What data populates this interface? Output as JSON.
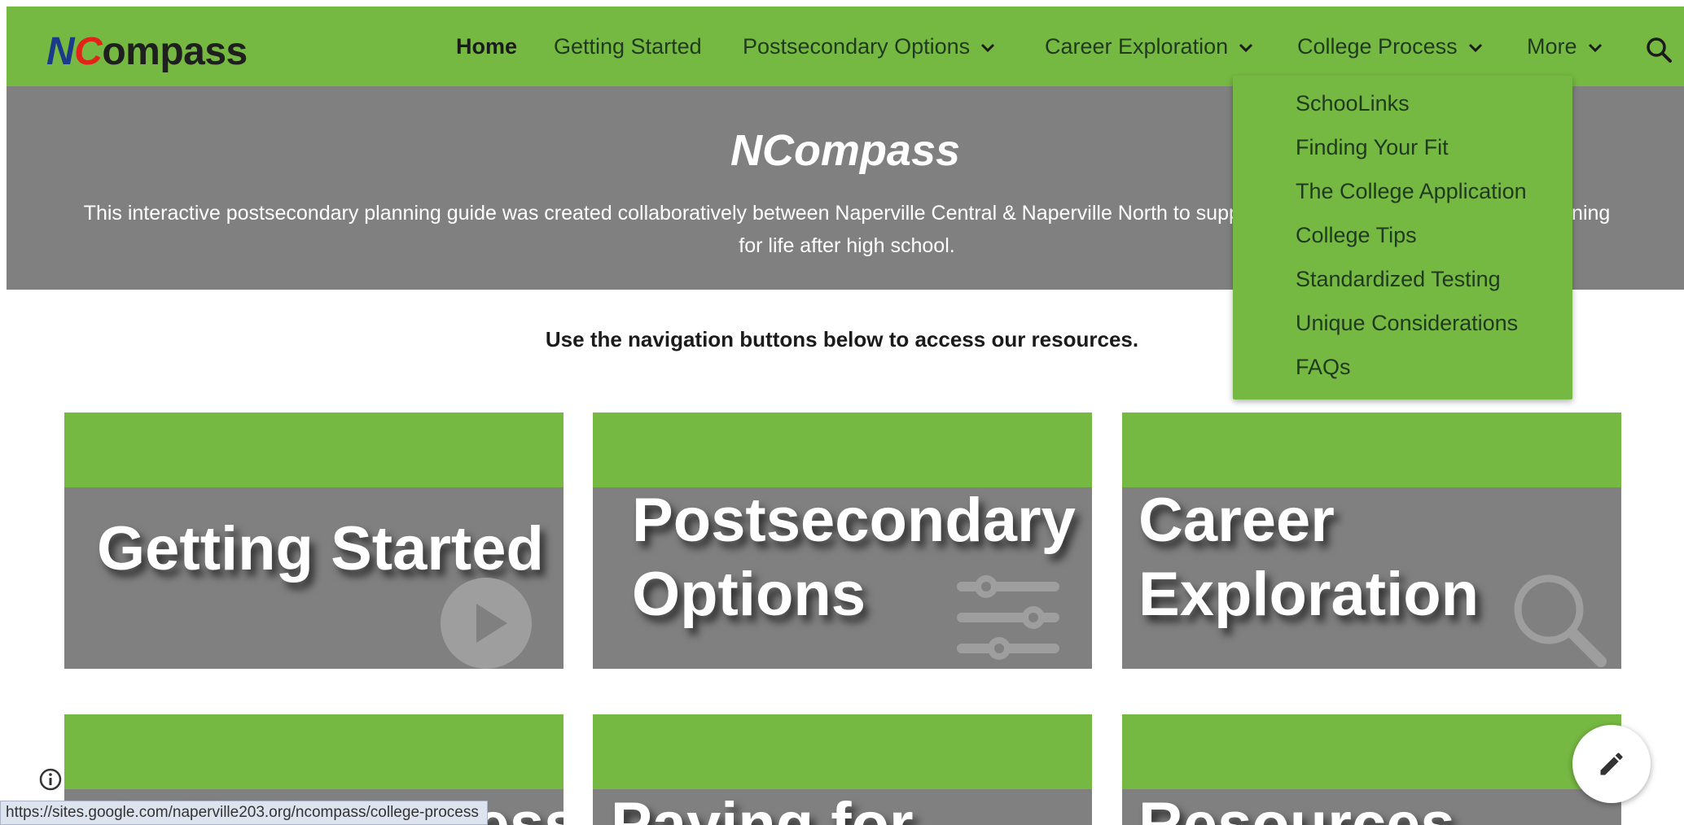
{
  "header": {
    "logo": {
      "part1": "N",
      "part2": "C",
      "part3": "ompass"
    },
    "nav": {
      "home": "Home",
      "getting_started": "Getting Started",
      "postsecondary": "Postsecondary Options",
      "career": "Career Exploration",
      "college": "College Process",
      "more": "More"
    }
  },
  "hero": {
    "title": "NCompass",
    "description": "This interactive postsecondary planning guide was created collaboratively between Naperville Central & Naperville North to support students and their families in planning for life after high school."
  },
  "instruction": "Use the navigation buttons below to access our resources.",
  "dropdown": {
    "items": [
      "SchooLinks",
      "Finding Your Fit",
      "The College Application",
      "College Tips",
      "Standardized Testing",
      "Unique Considerations",
      "FAQs"
    ]
  },
  "cards": [
    {
      "line1": "Getting Started",
      "line2": "",
      "icon": "play-icon"
    },
    {
      "line1": "Postsecondary",
      "line2": "Options",
      "icon": "sliders-icon"
    },
    {
      "line1": "Career",
      "line2": "Exploration",
      "icon": "magnifier-icon"
    },
    {
      "line1": "College Process",
      "line2": ""
    },
    {
      "line1": "Paying for",
      "line2": ""
    },
    {
      "line1": "Resources",
      "line2": ""
    }
  ],
  "status_url": "https://sites.google.com/naperville203.org/ncompass/college-process",
  "colors": {
    "accent_green": "#76b942",
    "hero_gray": "#808080",
    "text_dark": "#1b1b1b",
    "logo_blue": "#1b3a8a",
    "logo_red": "#e2231a"
  }
}
